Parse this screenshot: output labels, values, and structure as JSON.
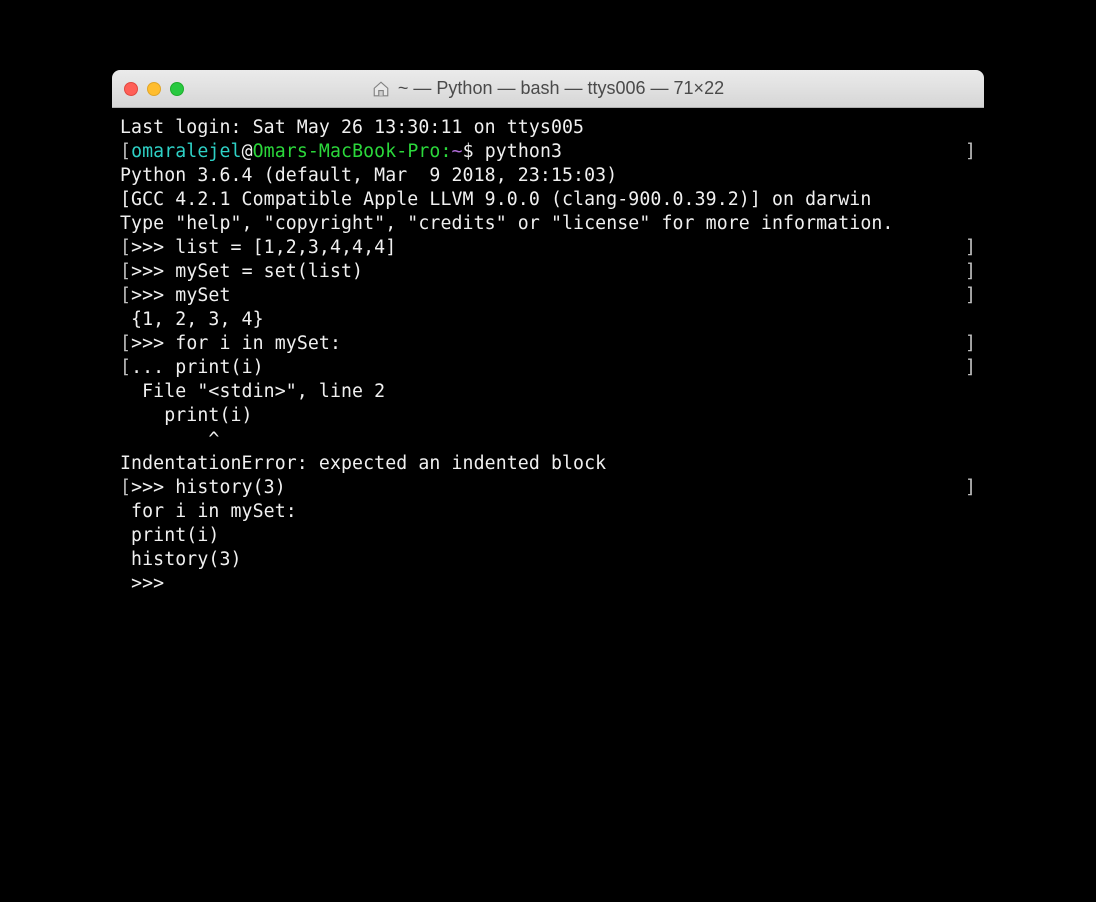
{
  "window": {
    "title": "~ — Python — bash — ttys006 — 71×22"
  },
  "colors": {
    "user": "#2ed1c6",
    "host": "#2bd83b",
    "tilde": "#b06cd8"
  },
  "terminal": {
    "last_login": "Last login: Sat May 26 13:30:11 on ttys005",
    "prompt_open_bracket": "[",
    "prompt_close_bracket": "]",
    "user": "omaralejel",
    "at": "@",
    "host": "Omars-MacBook-Pro:",
    "tilde": "~",
    "dollar": "$ ",
    "command": "python3",
    "py_version": "Python 3.6.4 (default, Mar  9 2018, 23:15:03) ",
    "py_compiler": "[GCC 4.2.1 Compatible Apple LLVM 9.0.0 (clang-900.0.39.2)] on darwin",
    "py_help": "Type \"help\", \"copyright\", \"credits\" or \"license\" for more information.",
    "repl_prefix": ">>> ",
    "cont_prefix": "... ",
    "l1": "list = [1,2,3,4,4,4]",
    "l2": "mySet = set(list)",
    "l3": "mySet",
    "out_set": " {1, 2, 3, 4}",
    "l4": "for i in mySet:",
    "l5": "print(i)",
    "err_file": "  File \"<stdin>\", line 2",
    "err_src": "    print(i)",
    "err_caret": "        ^",
    "err_msg": "IndentationError: expected an indented block",
    "l6": "history(3)",
    "hist1": " for i in mySet:",
    "hist2": " print(i)",
    "hist3": " history(3)",
    "empty_prompt": ">>> "
  }
}
